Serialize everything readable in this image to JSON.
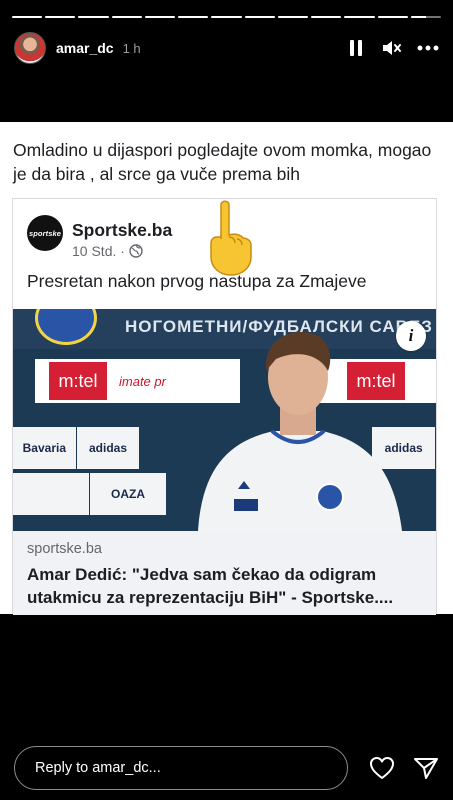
{
  "progress": {
    "segments": 13,
    "completed": 12,
    "current_fraction": 0.5
  },
  "header": {
    "username": "amar_dc",
    "time": "1 h",
    "icons": [
      "pause-icon",
      "mute-icon",
      "more-icon"
    ]
  },
  "post": {
    "caption": "Omladino u dijaspori pogledajte ovom momka, mogao je da bira , al srce ga vuče prema bih",
    "card": {
      "page_name": "Sportske.ba",
      "page_logo_text": "sportske",
      "meta": "10 Std. ·",
      "text": "Presretan nakon prvog nastupa za Zmajeve",
      "photo": {
        "banner_text": "НОГОМЕТНИ/ФУДБАЛСКИ САВЕЗ FOOTBALL ASSOCIATION BiH",
        "sponsors": [
          "m:tel",
          "imate pr",
          "m:tel",
          "Bavaria",
          "adidas",
          "OAZA",
          "adidas"
        ]
      },
      "link": {
        "domain": "sportske.ba",
        "title": "Amar Dedić: \"Jedva sam čekao da odigram utakmicu za reprezentaciju BiH\" - Sportske...."
      }
    }
  },
  "footer": {
    "reply_placeholder": "Reply to amar_dc...",
    "icons": [
      "heart-icon",
      "send-icon"
    ]
  },
  "colors": {
    "background": "#000000",
    "post_bg": "#ffffff",
    "link_bg": "#f0f2f5",
    "mtel_red": "#d51f34"
  }
}
